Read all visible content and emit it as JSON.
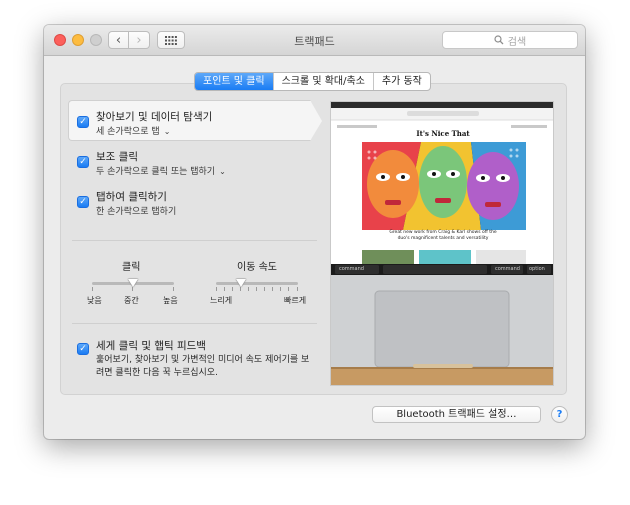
{
  "window": {
    "title": "트랙패드"
  },
  "toolbar": {
    "back_glyph": "‹",
    "forward_glyph": "›"
  },
  "search": {
    "placeholder": "검색"
  },
  "tabs": [
    {
      "label": "포인트 및 클릭",
      "active": true
    },
    {
      "label": "스크롤 및 확대/축소",
      "active": false
    },
    {
      "label": "추가 동작",
      "active": false
    }
  ],
  "options": [
    {
      "title": "찾아보기 및 데이터 탐색기",
      "subtitle": "세 손가락으로 탭",
      "checked": true,
      "has_menu": true
    },
    {
      "title": "보조 클릭",
      "subtitle": "두 손가락으로 클릭 또는 탭하기",
      "checked": true,
      "has_menu": true
    },
    {
      "title": "탭하여 클릭하기",
      "subtitle": "한 손가락으로 탭하기",
      "checked": true,
      "has_menu": false
    }
  ],
  "click_slider": {
    "title": "클릭",
    "min_label": "낮음",
    "mid_label": "중간",
    "max_label": "높음",
    "value": 0.5
  },
  "speed_slider": {
    "title": "이동 속도",
    "min_label": "느리게",
    "max_label": "빠르게",
    "value": 0.3
  },
  "force_click": {
    "title": "세게 클릭 및 햅틱 피드백",
    "checked": true,
    "description": "훑어보기, 찾아보기 및 가변적인 미디어 속도 제어기를 보려면 클릭한 다음 꾹 누르십시오."
  },
  "preview": {
    "site_title": "It's Nice That",
    "headline": "Great new work from Craig & Karl shows off the duo's magnificent talents and versatility",
    "keys": [
      "command",
      "command",
      "option"
    ]
  },
  "footer": {
    "bluetooth_button": "Bluetooth 트랙패드 설정…",
    "help_glyph": "?"
  },
  "colors": {
    "accent": "#1a7cf4",
    "window_bg": "#ececec",
    "panel_bg": "#e3e3e3"
  },
  "icons": {
    "search": "search-icon",
    "grid": "grid-icon",
    "check": "checkmark-icon",
    "chevron": "chevron-down-icon"
  }
}
